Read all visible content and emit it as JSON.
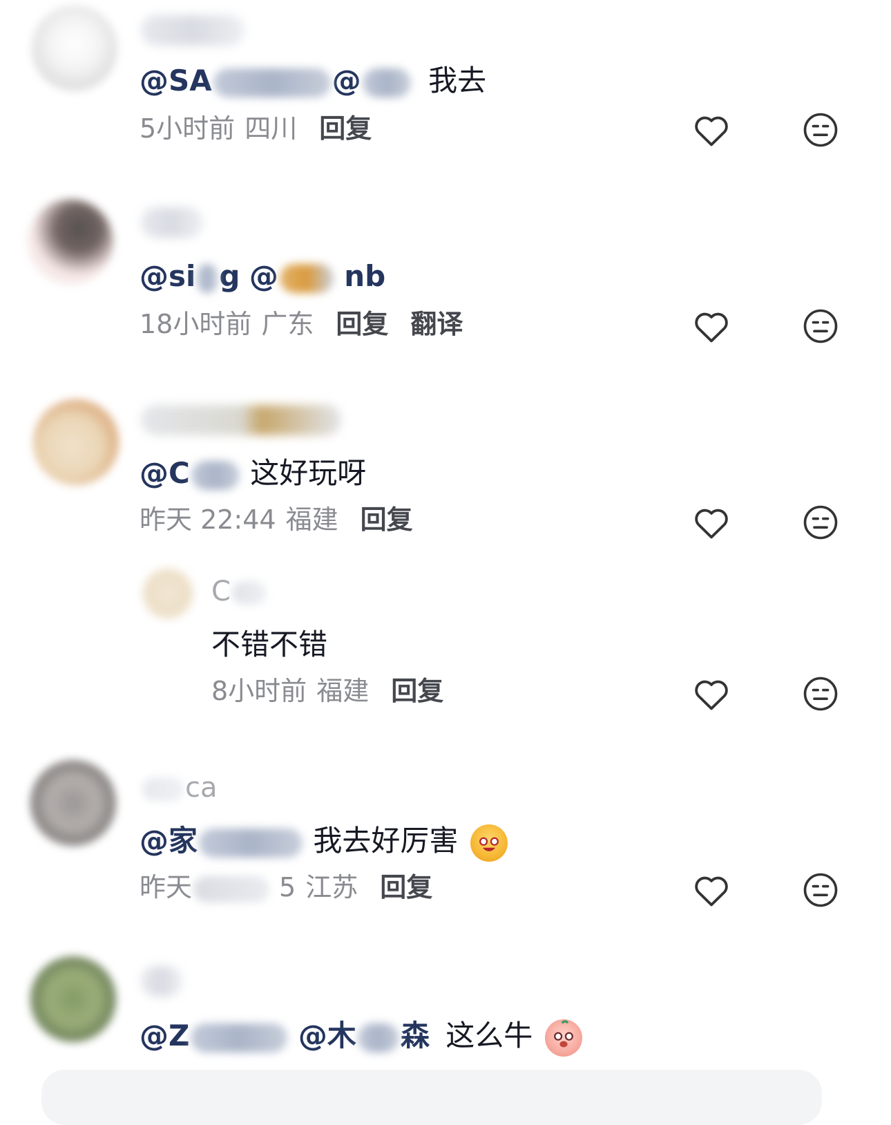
{
  "comments": [
    {
      "text_tail": "我去",
      "mention1": "@SA",
      "mention2": "@",
      "time": "5小时前",
      "region": "四川",
      "reply_label": "回复"
    },
    {
      "mention1": "@si",
      "mention1_tail": "g",
      "mention2": "@",
      "text_tail": "nb",
      "time": "18小时前",
      "region": "广东",
      "reply_label": "回复",
      "translate_label": "翻译"
    },
    {
      "mention1": "@C",
      "text_tail": "这好玩呀",
      "time": "昨天 22:44",
      "region": "福建",
      "reply_label": "回复"
    },
    {
      "username_visible": "C",
      "text": "不错不错",
      "time": "8小时前",
      "region": "福建",
      "reply_label": "回复"
    },
    {
      "username_visible": "ca",
      "mention1": "@家",
      "text_tail": "我去好厉害",
      "time_prefix": "昨天",
      "time_suffix": "5",
      "region": "江苏",
      "reply_label": "回复",
      "emoji": "laughing-cookie-emoji"
    },
    {
      "mention1": "@Z",
      "mention2": "@木",
      "mention2_tail": "森",
      "text_tail": "这么牛",
      "emoji": "shy-peach-emoji"
    }
  ],
  "icons": {
    "like": "heart-outline-icon",
    "dislike": "meh-face-icon"
  },
  "colors": {
    "text": "#161823",
    "mention": "#24355e",
    "meta": "#8a8b91",
    "action": "#45474e",
    "icon_stroke": "#333333"
  }
}
